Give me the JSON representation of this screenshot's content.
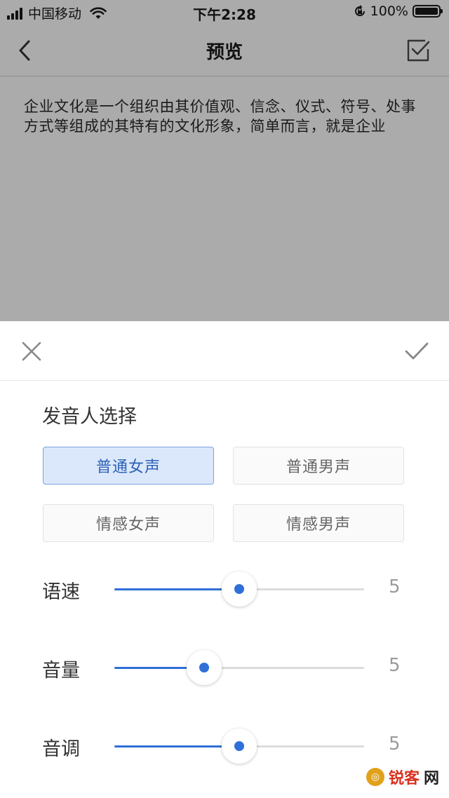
{
  "status_bar": {
    "carrier": "中国移动",
    "time": "下午2:28",
    "battery": "100%"
  },
  "nav": {
    "title": "预览",
    "back_icon": "chevron-left-icon",
    "confirm_icon": "checkbox-check-icon"
  },
  "preview": {
    "text": "企业文化是一个组织由其价值观、信念、仪式、符号、处事方式等组成的其特有的文化形象，简单而言，就是企业"
  },
  "sheet": {
    "close_icon": "close-icon",
    "confirm_icon": "check-icon",
    "section_title": "发音人选择",
    "voices": [
      {
        "label": "普通女声",
        "selected": true
      },
      {
        "label": "普通男声",
        "selected": false
      },
      {
        "label": "情感女声",
        "selected": false
      },
      {
        "label": "情感男声",
        "selected": false
      }
    ],
    "sliders": [
      {
        "label": "语速",
        "value": "5",
        "fraction": 0.5
      },
      {
        "label": "音量",
        "value": "5",
        "fraction": 0.36
      },
      {
        "label": "音调",
        "value": "5",
        "fraction": 0.5
      }
    ]
  },
  "watermark": {
    "part_a": "锐客",
    "part_b": "网"
  },
  "colors": {
    "accent": "#2f6fd8",
    "selected_bg": "#dbe8fb",
    "overlay": "#ababab"
  }
}
